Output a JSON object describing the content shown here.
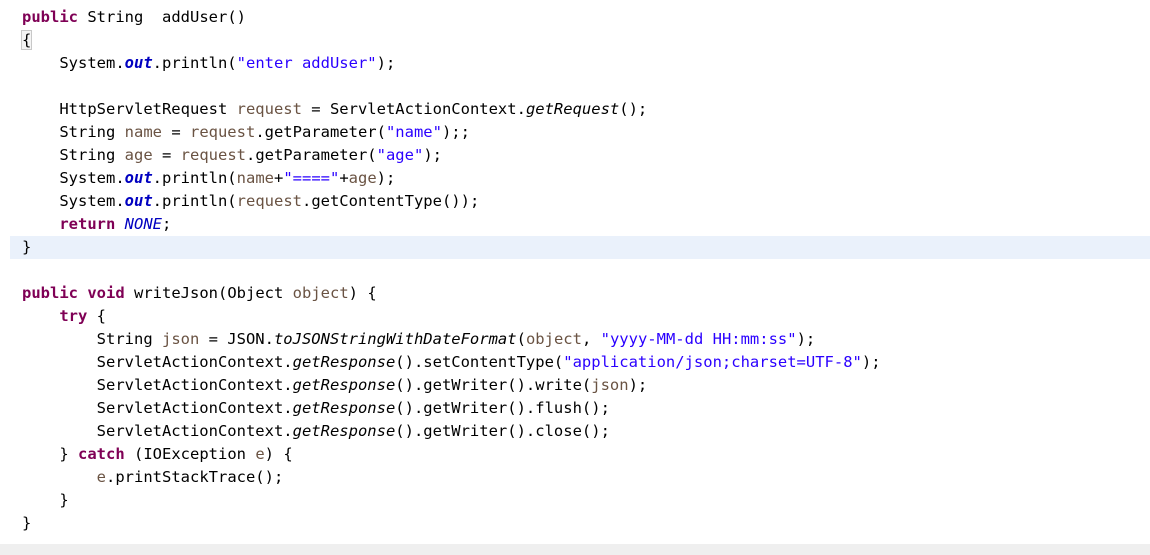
{
  "editor": {
    "language": "java",
    "background_color": "#ffffff",
    "highlight_color": "#eaf1fb",
    "bottom_band_color": "#efefef",
    "colors": {
      "keyword": "#7f0055",
      "string": "#2a00ff",
      "local_variable": "#6a5343",
      "static_field": "#0000c0",
      "plain_text": "#000000"
    },
    "highlighted_line_number": 10
  },
  "code": {
    "lines": [
      {
        "id": "line-1",
        "highlighted": false,
        "tokens": [
          {
            "t": "public",
            "c": "kw"
          },
          {
            "t": " ",
            "c": "plain"
          },
          {
            "t": "String",
            "c": "type"
          },
          {
            "t": "  ",
            "c": "plain"
          },
          {
            "t": "addUser()",
            "c": "plain"
          }
        ]
      },
      {
        "id": "line-2",
        "highlighted": false,
        "tokens": [
          {
            "t": "{",
            "c": "bracket"
          }
        ]
      },
      {
        "id": "line-3",
        "highlighted": false,
        "tokens": [
          {
            "t": "    System.",
            "c": "plain"
          },
          {
            "t": "out",
            "c": "field"
          },
          {
            "t": ".println(",
            "c": "plain"
          },
          {
            "t": "\"enter addUser\"",
            "c": "str"
          },
          {
            "t": ");",
            "c": "plain"
          }
        ]
      },
      {
        "id": "line-4",
        "highlighted": false,
        "tokens": []
      },
      {
        "id": "line-5",
        "highlighted": false,
        "tokens": [
          {
            "t": "    HttpServletRequest ",
            "c": "plain"
          },
          {
            "t": "request",
            "c": "var"
          },
          {
            "t": " = ServletActionContext.",
            "c": "plain"
          },
          {
            "t": "getRequest",
            "c": "smethod"
          },
          {
            "t": "();",
            "c": "plain"
          }
        ]
      },
      {
        "id": "line-6",
        "highlighted": false,
        "tokens": [
          {
            "t": "    String ",
            "c": "plain"
          },
          {
            "t": "name",
            "c": "var"
          },
          {
            "t": " = ",
            "c": "plain"
          },
          {
            "t": "request",
            "c": "var"
          },
          {
            "t": ".getParameter(",
            "c": "plain"
          },
          {
            "t": "\"name\"",
            "c": "str"
          },
          {
            "t": ");;",
            "c": "plain"
          }
        ]
      },
      {
        "id": "line-7",
        "highlighted": false,
        "tokens": [
          {
            "t": "    String ",
            "c": "plain"
          },
          {
            "t": "age",
            "c": "var"
          },
          {
            "t": " = ",
            "c": "plain"
          },
          {
            "t": "request",
            "c": "var"
          },
          {
            "t": ".getParameter(",
            "c": "plain"
          },
          {
            "t": "\"age\"",
            "c": "str"
          },
          {
            "t": ");",
            "c": "plain"
          }
        ]
      },
      {
        "id": "line-8",
        "highlighted": false,
        "tokens": [
          {
            "t": "    System.",
            "c": "plain"
          },
          {
            "t": "out",
            "c": "field"
          },
          {
            "t": ".println(",
            "c": "plain"
          },
          {
            "t": "name",
            "c": "var"
          },
          {
            "t": "+",
            "c": "plain"
          },
          {
            "t": "\"====\"",
            "c": "str"
          },
          {
            "t": "+",
            "c": "plain"
          },
          {
            "t": "age",
            "c": "var"
          },
          {
            "t": ");",
            "c": "plain"
          }
        ]
      },
      {
        "id": "line-9",
        "highlighted": false,
        "tokens": [
          {
            "t": "    System.",
            "c": "plain"
          },
          {
            "t": "out",
            "c": "field"
          },
          {
            "t": ".println(",
            "c": "plain"
          },
          {
            "t": "request",
            "c": "var"
          },
          {
            "t": ".getContentType());",
            "c": "plain"
          }
        ]
      },
      {
        "id": "line-10",
        "highlighted": false,
        "tokens": [
          {
            "t": "    ",
            "c": "plain"
          },
          {
            "t": "return",
            "c": "kw"
          },
          {
            "t": " ",
            "c": "plain"
          },
          {
            "t": "NONE",
            "c": "sfield"
          },
          {
            "t": ";",
            "c": "plain"
          }
        ]
      },
      {
        "id": "line-11",
        "highlighted": true,
        "tokens": [
          {
            "t": "}",
            "c": "plain"
          }
        ]
      },
      {
        "id": "line-12",
        "highlighted": false,
        "tokens": []
      },
      {
        "id": "line-13",
        "highlighted": false,
        "tokens": [
          {
            "t": "public",
            "c": "kw"
          },
          {
            "t": " ",
            "c": "plain"
          },
          {
            "t": "void",
            "c": "kw"
          },
          {
            "t": " writeJson(Object ",
            "c": "plain"
          },
          {
            "t": "object",
            "c": "var"
          },
          {
            "t": ") {",
            "c": "plain"
          }
        ]
      },
      {
        "id": "line-14",
        "highlighted": false,
        "tokens": [
          {
            "t": "    ",
            "c": "plain"
          },
          {
            "t": "try",
            "c": "kw"
          },
          {
            "t": " {",
            "c": "plain"
          }
        ]
      },
      {
        "id": "line-15",
        "highlighted": false,
        "tokens": [
          {
            "t": "        String ",
            "c": "plain"
          },
          {
            "t": "json",
            "c": "var"
          },
          {
            "t": " = JSON.",
            "c": "plain"
          },
          {
            "t": "toJSONStringWithDateFormat",
            "c": "smethod"
          },
          {
            "t": "(",
            "c": "plain"
          },
          {
            "t": "object",
            "c": "var"
          },
          {
            "t": ", ",
            "c": "plain"
          },
          {
            "t": "\"yyyy-MM-dd HH:mm:ss\"",
            "c": "str"
          },
          {
            "t": ");",
            "c": "plain"
          }
        ]
      },
      {
        "id": "line-16",
        "highlighted": false,
        "tokens": [
          {
            "t": "        ServletActionContext.",
            "c": "plain"
          },
          {
            "t": "getResponse",
            "c": "smethod"
          },
          {
            "t": "().setContentType(",
            "c": "plain"
          },
          {
            "t": "\"application/json;charset=UTF-8\"",
            "c": "str"
          },
          {
            "t": ");",
            "c": "plain"
          }
        ]
      },
      {
        "id": "line-17",
        "highlighted": false,
        "tokens": [
          {
            "t": "        ServletActionContext.",
            "c": "plain"
          },
          {
            "t": "getResponse",
            "c": "smethod"
          },
          {
            "t": "().getWriter().write(",
            "c": "plain"
          },
          {
            "t": "json",
            "c": "var"
          },
          {
            "t": ");",
            "c": "plain"
          }
        ]
      },
      {
        "id": "line-18",
        "highlighted": false,
        "tokens": [
          {
            "t": "        ServletActionContext.",
            "c": "plain"
          },
          {
            "t": "getResponse",
            "c": "smethod"
          },
          {
            "t": "().getWriter().flush();",
            "c": "plain"
          }
        ]
      },
      {
        "id": "line-19",
        "highlighted": false,
        "tokens": [
          {
            "t": "        ServletActionContext.",
            "c": "plain"
          },
          {
            "t": "getResponse",
            "c": "smethod"
          },
          {
            "t": "().getWriter().close();",
            "c": "plain"
          }
        ]
      },
      {
        "id": "line-20",
        "highlighted": false,
        "tokens": [
          {
            "t": "    } ",
            "c": "plain"
          },
          {
            "t": "catch",
            "c": "kw"
          },
          {
            "t": " (IOException ",
            "c": "plain"
          },
          {
            "t": "e",
            "c": "var"
          },
          {
            "t": ") {",
            "c": "plain"
          }
        ]
      },
      {
        "id": "line-21",
        "highlighted": false,
        "tokens": [
          {
            "t": "        ",
            "c": "plain"
          },
          {
            "t": "e",
            "c": "var"
          },
          {
            "t": ".printStackTrace();",
            "c": "plain"
          }
        ]
      },
      {
        "id": "line-22",
        "highlighted": false,
        "tokens": [
          {
            "t": "    }",
            "c": "plain"
          }
        ]
      },
      {
        "id": "line-23",
        "highlighted": false,
        "tokens": [
          {
            "t": "}",
            "c": "plain"
          }
        ]
      }
    ]
  }
}
